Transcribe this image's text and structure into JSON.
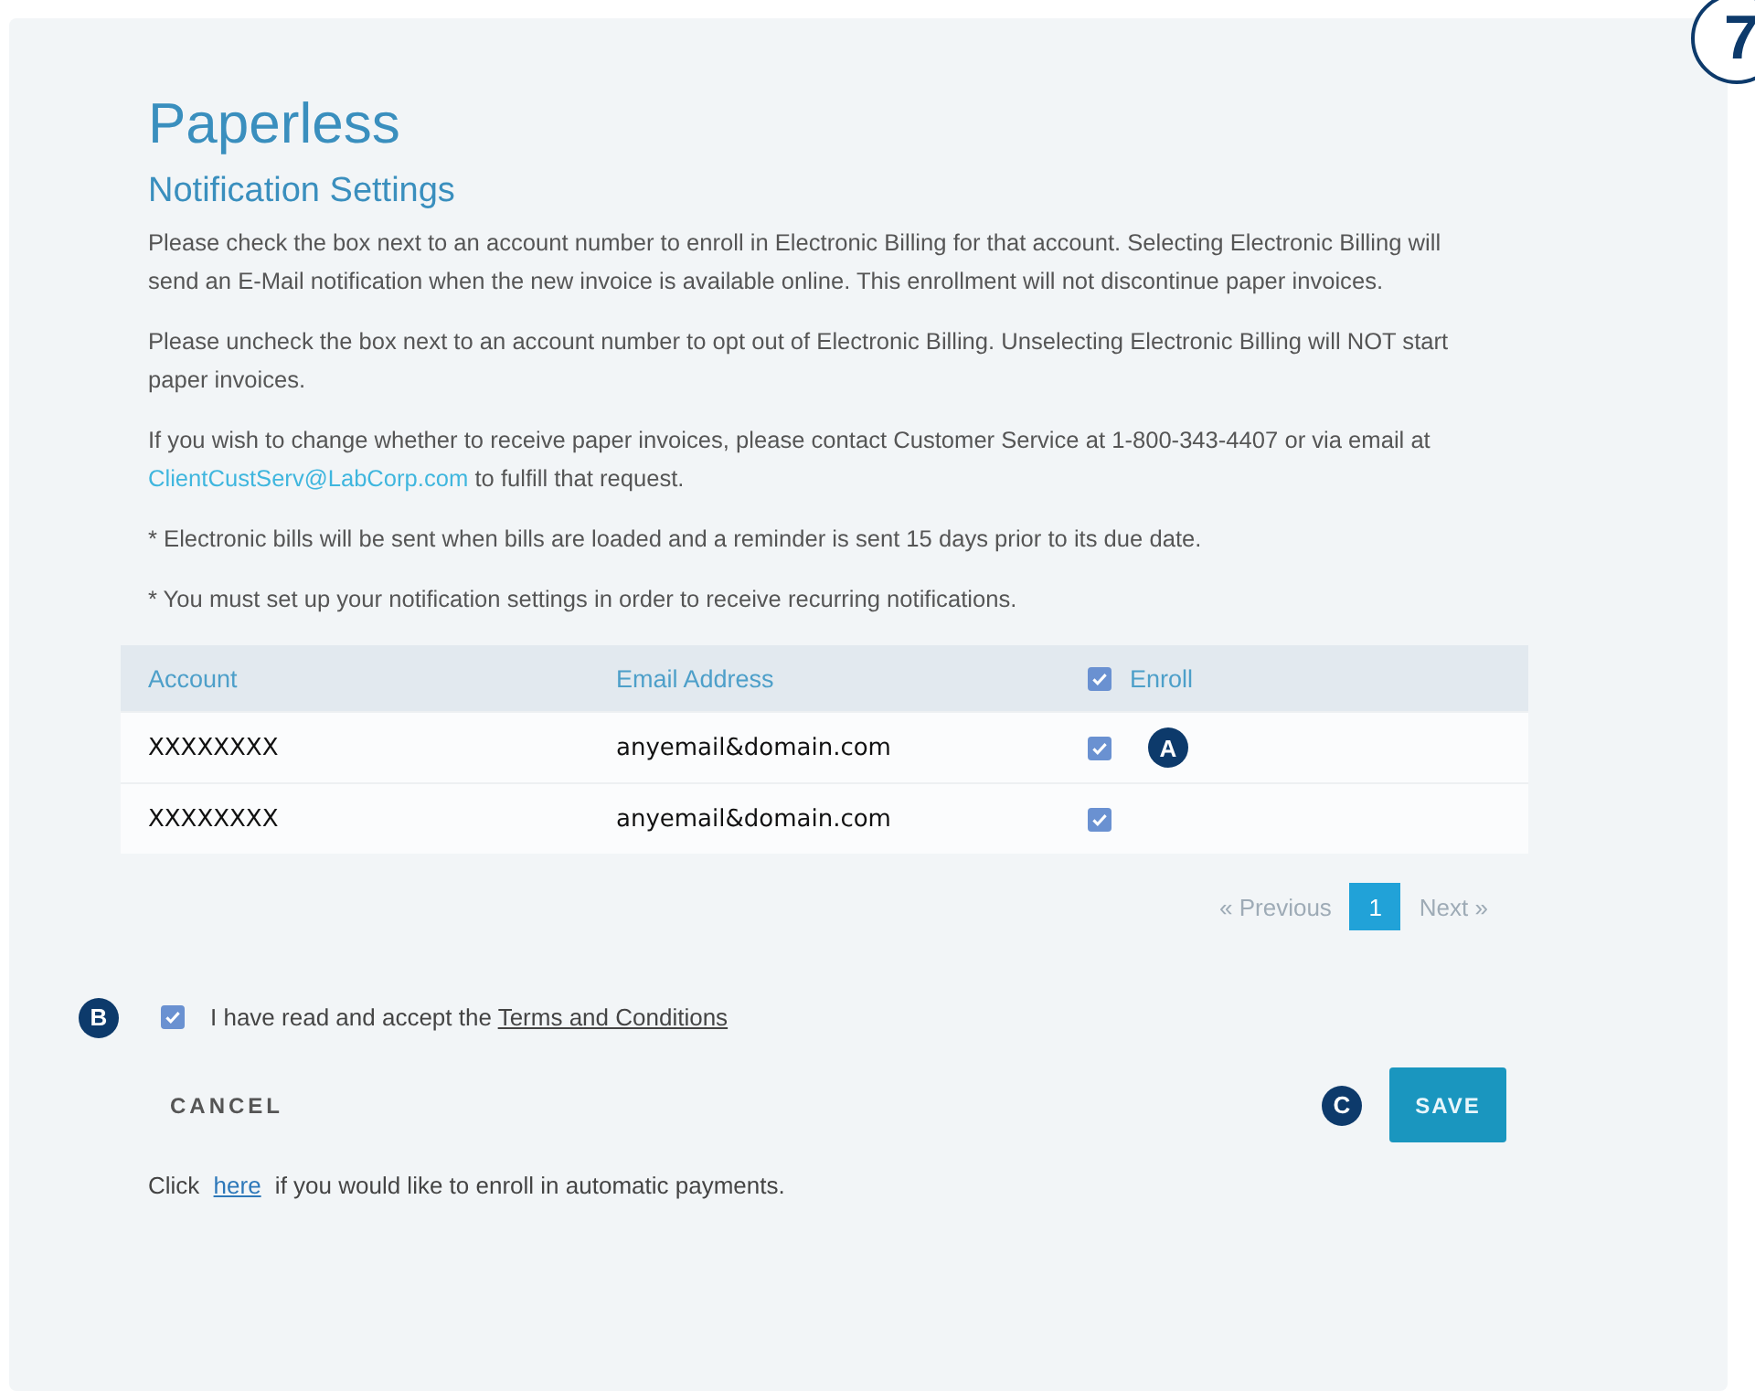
{
  "page_badge": "7",
  "title": "Paperless",
  "subtitle": "Notification Settings",
  "paragraphs": [
    {
      "parts": [
        {
          "text": "Please check the box next to an account number to enroll in Electronic Billing for that account. Selecting Electronic Billing will send an E-Mail notification when the new invoice is available online. This enrollment will not discontinue paper invoices."
        }
      ]
    },
    {
      "parts": [
        {
          "text": "Please uncheck the box next to an account number to opt out of Electronic Billing. Unselecting Electronic Billing will NOT start paper invoices."
        }
      ]
    },
    {
      "parts": [
        {
          "text": "If you wish to change whether to receive paper invoices, please contact Customer Service at 1-800-343-4407 or via email at "
        },
        {
          "text": "ClientCustServ@LabCorp.com",
          "kind": "link"
        },
        {
          "text": " to fulfill that request."
        }
      ]
    },
    {
      "parts": [
        {
          "text": "* Electronic bills will be sent when bills are loaded and a reminder is sent 15 days prior to its due date."
        }
      ]
    },
    {
      "parts": [
        {
          "text": "* You must set up your notification settings in order to receive recurring notifications."
        }
      ]
    }
  ],
  "table": {
    "columns": [
      "Account",
      "Email Address",
      "Enroll"
    ],
    "enroll_all_checked": true,
    "rows": [
      {
        "account": "XXXXXXXX",
        "email": "anyemail&domain.com",
        "enroll": true,
        "marker": "A"
      },
      {
        "account": "XXXXXXXX",
        "email": "anyemail&domain.com",
        "enroll": true
      }
    ]
  },
  "pagination": {
    "previous": "« Previous",
    "pages": [
      {
        "label": "1",
        "selected": true
      }
    ],
    "next": "Next »"
  },
  "terms": {
    "checked": true,
    "text": "I have read and accept the",
    "link": "Terms and Conditions",
    "marker": "B"
  },
  "cancel": "CANCEL",
  "save": {
    "label": "SAVE",
    "marker": "C"
  },
  "footer": {
    "before": "Click",
    "link": "here",
    "after": "if you would like to enroll in automatic payments."
  }
}
